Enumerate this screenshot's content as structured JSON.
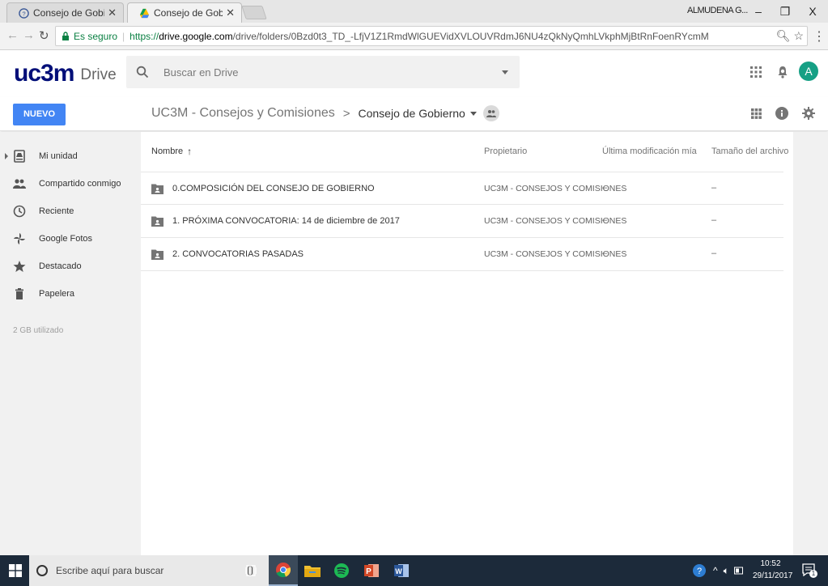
{
  "browser": {
    "tabs": [
      {
        "title": "Consejo de Gobierno - Ir",
        "active": false
      },
      {
        "title": "Consejo de Gobierno - C",
        "active": true
      }
    ],
    "user": "ALMUDENA G...",
    "window_controls": {
      "minimize": "–",
      "maximize": "❐",
      "close": "X"
    },
    "address": {
      "secure_label": "Es seguro",
      "url_scheme": "https://",
      "url_host": "drive.google.com",
      "url_path": "/drive/folders/0Bzd0t3_TD_-LfjV1Z1RmdWlGUEVidXVLOUVRdmJ6NU4zQkNyQmhLVkphMjBtRnFoenRYcmM"
    }
  },
  "drive": {
    "logo_text": "uc3m",
    "product_name": "Drive",
    "search_placeholder": "Buscar en Drive",
    "avatar_initial": "A",
    "new_button": "NUEVO",
    "breadcrumb": {
      "parent": "UC3M - Consejos y Comisiones",
      "separator": ">",
      "current": "Consejo de Gobierno"
    },
    "sidebar": {
      "items": [
        {
          "label": "Mi unidad",
          "icon": "drive-icon"
        },
        {
          "label": "Compartido conmigo",
          "icon": "people-icon"
        },
        {
          "label": "Reciente",
          "icon": "clock-icon"
        },
        {
          "label": "Google Fotos",
          "icon": "pinwheel-icon"
        },
        {
          "label": "Destacado",
          "icon": "star-icon"
        },
        {
          "label": "Papelera",
          "icon": "trash-icon"
        }
      ],
      "storage": "2 GB utilizado"
    },
    "columns": {
      "name": "Nombre",
      "sort_arrow": "↑",
      "owner": "Propietario",
      "modified": "Última modificación mía",
      "size": "Tamaño del archivo"
    },
    "files": [
      {
        "name": "0.COMPOSICIÓN DEL CONSEJO DE GOBIERNO",
        "owner": "UC3M - CONSEJOS Y COMISIONES",
        "modified": "–",
        "size": "–"
      },
      {
        "name": "1. PRÓXIMA CONVOCATORIA: 14 de diciembre de 2017",
        "owner": "UC3M - CONSEJOS Y COMISIONES",
        "modified": "–",
        "size": "–"
      },
      {
        "name": "2. CONVOCATORIAS PASADAS",
        "owner": "UC3M - CONSEJOS Y COMISIONES",
        "modified": "–",
        "size": "–"
      }
    ]
  },
  "taskbar": {
    "search_placeholder": "Escribe aquí para buscar",
    "time": "10:52",
    "date": "29/11/2017",
    "notification_count": "1"
  },
  "colors": {
    "accent_blue": "#4285f4",
    "uc3m_navy": "#000e78",
    "avatar": "#16a085",
    "taskbar": "#1c2a3a"
  }
}
